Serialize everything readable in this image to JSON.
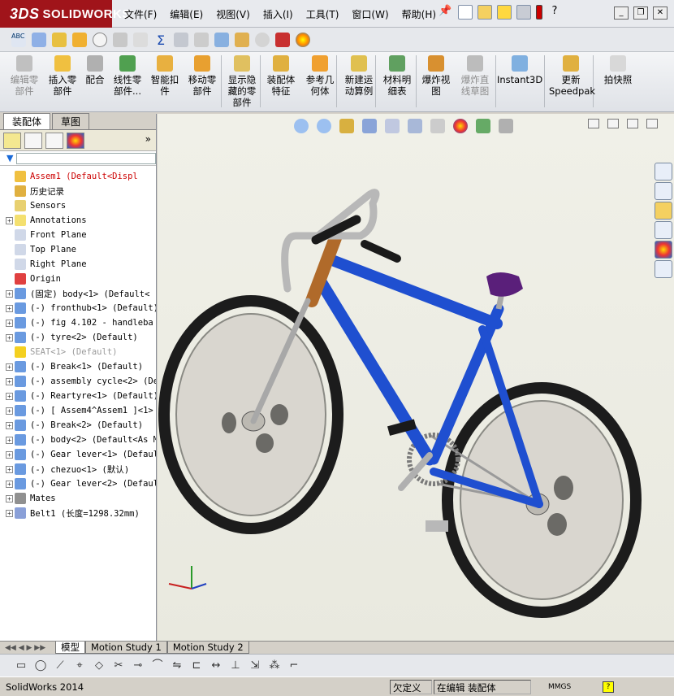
{
  "app": {
    "brand_prefix": "3DS",
    "brand": "SOLIDWORKS"
  },
  "menu": [
    "文件(F)",
    "编辑(E)",
    "视图(V)",
    "插入(I)",
    "工具(T)",
    "窗口(W)",
    "帮助(H)"
  ],
  "ribbon": [
    {
      "label": "编辑零\n部件",
      "disabled": true
    },
    {
      "label": "插入零\n部件",
      "disabled": false
    },
    {
      "label": "配合",
      "disabled": false
    },
    {
      "label": "线性零\n部件...",
      "disabled": false
    },
    {
      "label": "智能扣\n件",
      "disabled": false
    },
    {
      "label": "移动零\n部件",
      "disabled": false
    },
    {
      "label": "显示隐\n藏的零\n部件",
      "disabled": false
    },
    {
      "label": "装配体\n特征",
      "disabled": false
    },
    {
      "label": "参考几\n何体",
      "disabled": false
    },
    {
      "label": "新建运\n动算例",
      "disabled": false
    },
    {
      "label": "材料明\n细表",
      "disabled": false
    },
    {
      "label": "爆炸视\n图",
      "disabled": false
    },
    {
      "label": "爆炸直\n线草图",
      "disabled": true
    },
    {
      "label": "Instant3D",
      "disabled": false
    },
    {
      "label": "更新\nSpeedpak",
      "disabled": false
    },
    {
      "label": "拍快照",
      "disabled": false
    }
  ],
  "panel_tabs": [
    "装配体",
    "草图"
  ],
  "tree": [
    {
      "label": "Assem1  (Default<Displ",
      "icon": "assembly-icon",
      "expand": false,
      "type": "root"
    },
    {
      "label": "历史记录",
      "icon": "history-icon",
      "expand": false,
      "type": "normal"
    },
    {
      "label": "Sensors",
      "icon": "sensor-icon",
      "expand": false,
      "type": "normal"
    },
    {
      "label": "Annotations",
      "icon": "annotation-icon",
      "expand": true,
      "type": "normal"
    },
    {
      "label": "Front Plane",
      "icon": "plane-icon",
      "expand": false,
      "type": "normal"
    },
    {
      "label": "Top Plane",
      "icon": "plane-icon",
      "expand": false,
      "type": "normal"
    },
    {
      "label": "Right Plane",
      "icon": "plane-icon",
      "expand": false,
      "type": "normal"
    },
    {
      "label": "Origin",
      "icon": "origin-icon",
      "expand": false,
      "type": "normal"
    },
    {
      "label": "(固定) body<1> (Default<",
      "icon": "part-icon",
      "expand": true,
      "type": "normal"
    },
    {
      "label": "(-) fronthub<1> (Default)",
      "icon": "part-icon",
      "expand": true,
      "type": "normal"
    },
    {
      "label": "(-) fig 4.102 - handleba",
      "icon": "part-icon",
      "expand": true,
      "type": "normal"
    },
    {
      "label": "(-) tyre<2> (Default)",
      "icon": "part-icon",
      "expand": true,
      "type": "normal"
    },
    {
      "label": "SEAT<1> (Default)",
      "icon": "warning-icon",
      "expand": false,
      "type": "sup"
    },
    {
      "label": "(-) Break<1> (Default)",
      "icon": "part-icon",
      "expand": true,
      "type": "normal"
    },
    {
      "label": "(-) assembly cycle<2> (De",
      "icon": "part-icon",
      "expand": true,
      "type": "normal"
    },
    {
      "label": "(-) Reartyre<1> (Default)",
      "icon": "part-icon",
      "expand": true,
      "type": "normal"
    },
    {
      "label": "(-) [ Assem4^Assem1 ]<1>",
      "icon": "part-icon",
      "expand": true,
      "type": "normal"
    },
    {
      "label": "(-) Break<2> (Default)",
      "icon": "part-icon",
      "expand": true,
      "type": "normal"
    },
    {
      "label": "(-) body<2> (Default<As M",
      "icon": "part-icon",
      "expand": true,
      "type": "normal"
    },
    {
      "label": "(-) Gear lever<1> (Defaul",
      "icon": "part-icon",
      "expand": true,
      "type": "normal"
    },
    {
      "label": "(-) chezuo<1> (默认)",
      "icon": "part-icon",
      "expand": true,
      "type": "normal"
    },
    {
      "label": "(-) Gear lever<2> (Defaul",
      "icon": "part-icon",
      "expand": true,
      "type": "normal"
    },
    {
      "label": "Mates",
      "icon": "mates-icon",
      "expand": true,
      "type": "normal"
    },
    {
      "label": "Belt1 (长度=1298.32mm)",
      "icon": "belt-icon",
      "expand": true,
      "type": "normal"
    }
  ],
  "bottom_tabs": [
    "模型",
    "Motion Study 1",
    "Motion Study 2"
  ],
  "status": {
    "app": "SolidWorks 2014",
    "state1": "欠定义",
    "state2": "在编辑 装配体",
    "units": "MMGS",
    "help": "?"
  },
  "colors": {
    "frame": "#1f4fd0",
    "tire": "#202020",
    "hub": "#d8d4cc",
    "seat": "#5a1f7a",
    "bg": "#ecece2"
  }
}
